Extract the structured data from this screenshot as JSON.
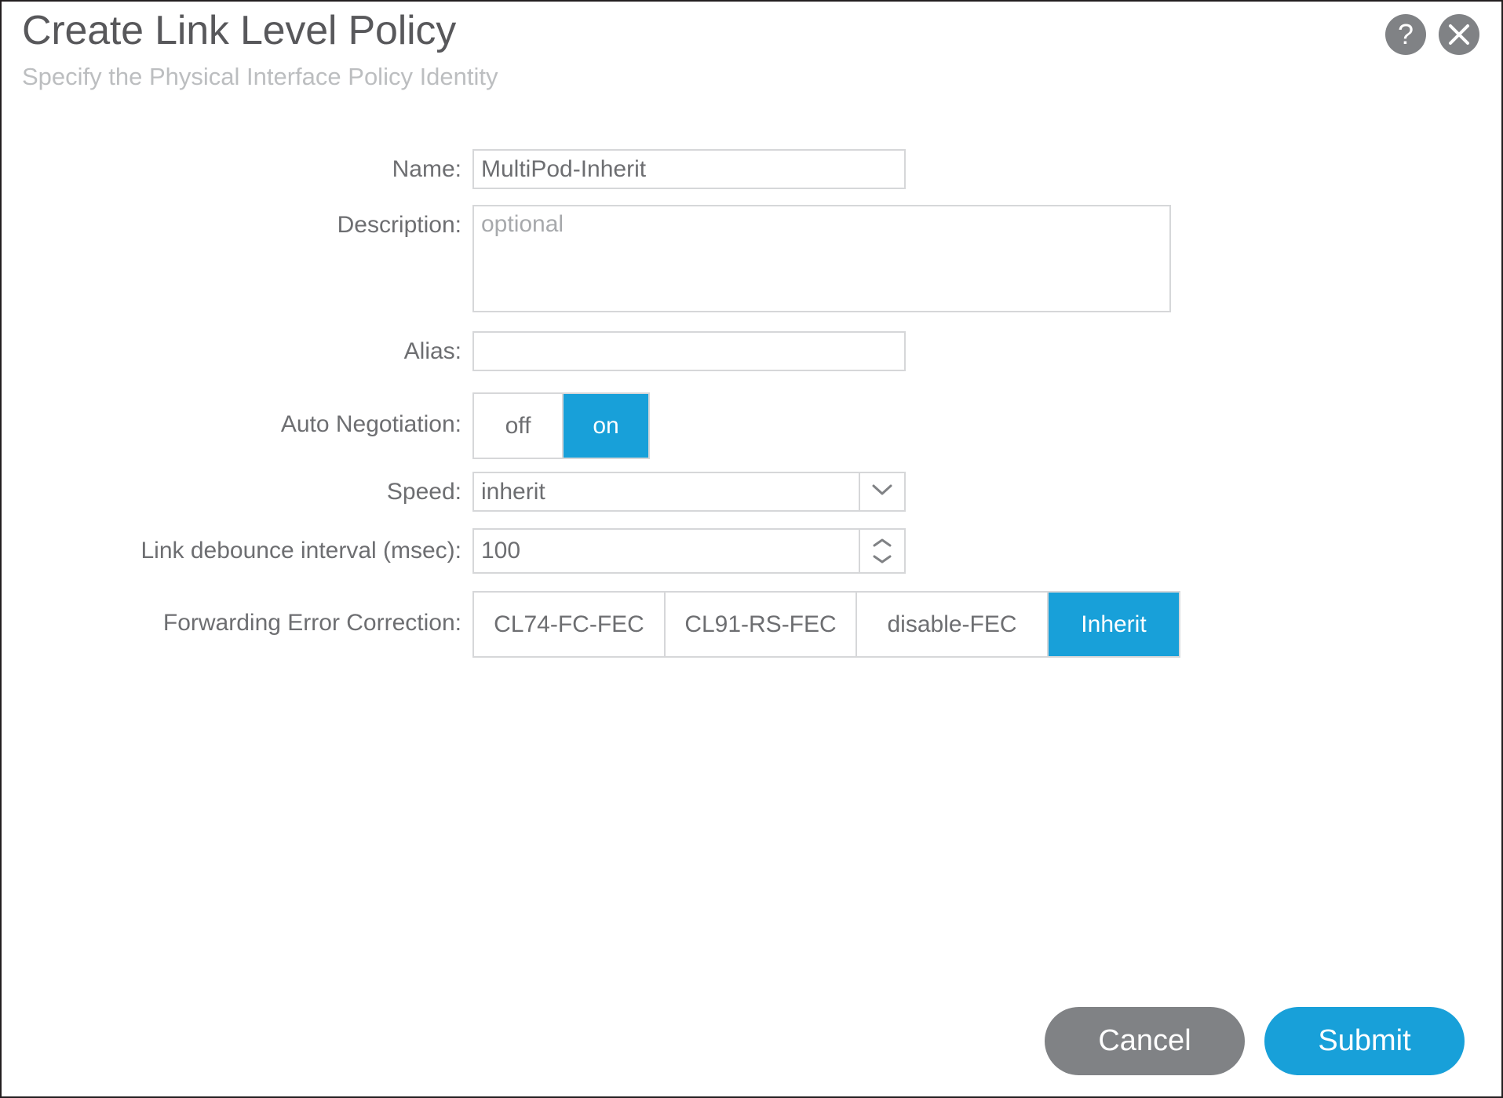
{
  "dialog": {
    "title": "Create Link Level Policy",
    "subtitle": "Specify the Physical Interface Policy Identity",
    "help_icon": "question-mark-icon",
    "close_icon": "close-x-icon"
  },
  "colors": {
    "accent": "#18a0d9",
    "label_text": "#6d6e71",
    "title_text": "#58585b",
    "subtitle_text": "#bcbec0",
    "border": "#d6d7d9",
    "cancel_gray": "#808285"
  },
  "fields": {
    "name": {
      "label": "Name:",
      "value": "MultiPod-Inherit",
      "placeholder": ""
    },
    "description": {
      "label": "Description:",
      "value": "",
      "placeholder": "optional"
    },
    "alias": {
      "label": "Alias:",
      "value": "",
      "placeholder": ""
    },
    "auto_negotiation": {
      "label": "Auto Negotiation:",
      "options": [
        "off",
        "on"
      ],
      "selected": "on"
    },
    "speed": {
      "label": "Speed:",
      "value": "inherit",
      "options": [
        "inherit"
      ],
      "arrow_icon": "chevron-down-icon"
    },
    "link_debounce": {
      "label": "Link debounce interval (msec):",
      "value": "100",
      "up_icon": "chevron-up-icon",
      "down_icon": "chevron-down-icon"
    },
    "forwarding_error_correction": {
      "label": "Forwarding Error Correction:",
      "options": [
        "CL74-FC-FEC",
        "CL91-RS-FEC",
        "disable-FEC",
        "Inherit"
      ],
      "selected": "Inherit"
    }
  },
  "footer": {
    "cancel_label": "Cancel",
    "submit_label": "Submit"
  }
}
